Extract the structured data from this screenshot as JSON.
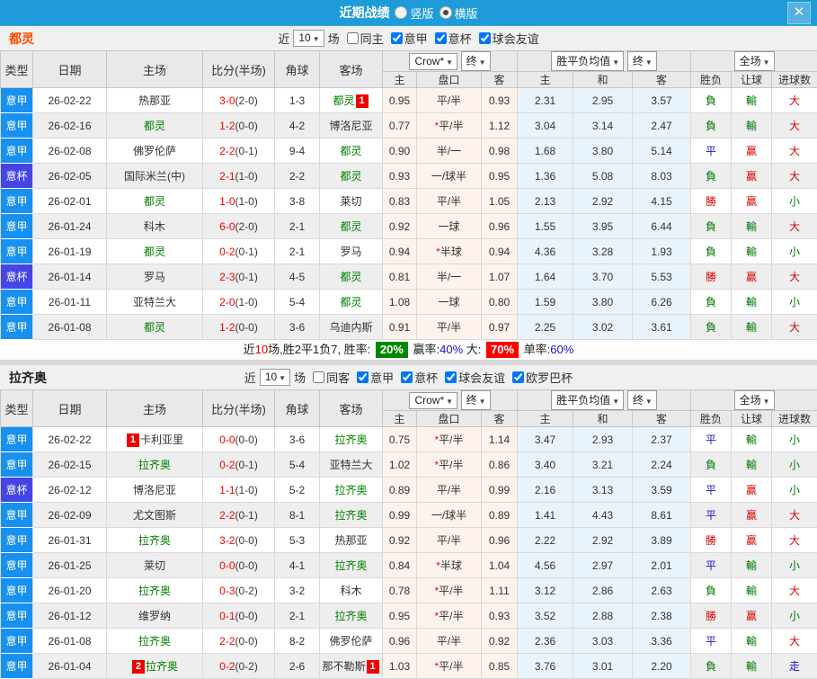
{
  "titlebar": {
    "title": "近期战绩",
    "radio_options": [
      {
        "label": "竖版",
        "selected": false
      },
      {
        "label": "横版",
        "selected": true
      }
    ],
    "close_label": "✕"
  },
  "table_header": {
    "type": "类型",
    "date": "日期",
    "home": "主场",
    "score": "比分(半场)",
    "corner": "角球",
    "away": "客场",
    "crow_dd": "Crow*",
    "final_dd": "终",
    "avg_dd": "胜平负均值",
    "final2_dd": "终",
    "full_dd": "全场",
    "sub": [
      "主",
      "盘口",
      "客",
      "主",
      "和",
      "客",
      "胜负",
      "让球",
      "进球数"
    ]
  },
  "colors": {
    "titlebar": "#1e9bd8",
    "serie_a": "#1890f0",
    "coppa": "#4545e6",
    "team_self": "#008000",
    "score_red": "#ff0000",
    "badge_red": "#ee0000",
    "crow_bg": "#fdf3ec",
    "avg_bg": "#e9f3fb",
    "win_red": "#dd0000",
    "lose_green": "#007700",
    "draw_blue": "#1414cc"
  },
  "sections": [
    {
      "team": "都灵",
      "team_color": "#ff4800",
      "filter": {
        "near": "近",
        "count": "10",
        "games": "场",
        "checkboxes": [
          {
            "label": "同主",
            "checked": false
          },
          {
            "label": "意甲",
            "checked": true
          },
          {
            "label": "意杯",
            "checked": true
          },
          {
            "label": "球会友谊",
            "checked": true
          }
        ]
      },
      "rows": [
        {
          "league": "意甲",
          "league_style": "jia",
          "date": "26-02-22",
          "home": {
            "name": "热那亚"
          },
          "score": "3-0",
          "half": "(2-0)",
          "corner": "1-3",
          "away": {
            "name": "都灵",
            "self": true,
            "badge_post": "1"
          },
          "crow_home": "0.95",
          "handicap": "平/半",
          "handicap_star": false,
          "crow_away": "0.93",
          "avg_home": "2.31",
          "avg_draw": "2.95",
          "avg_away": "3.57",
          "result": "負",
          "result_color": "green",
          "let": "輸",
          "let_color": "green",
          "goals": "大",
          "goals_color": "red"
        },
        {
          "league": "意甲",
          "league_style": "jia",
          "date": "26-02-16",
          "home": {
            "name": "都灵",
            "self": true
          },
          "score": "1-2",
          "half": "(0-0)",
          "corner": "4-2",
          "away": {
            "name": "博洛尼亚"
          },
          "crow_home": "0.77",
          "handicap": "平/半",
          "handicap_star": true,
          "crow_away": "1.12",
          "avg_home": "3.04",
          "avg_draw": "3.14",
          "avg_away": "2.47",
          "result": "負",
          "result_color": "green",
          "let": "輸",
          "let_color": "green",
          "goals": "大",
          "goals_color": "red"
        },
        {
          "league": "意甲",
          "league_style": "jia",
          "date": "26-02-08",
          "home": {
            "name": "佛罗伦萨"
          },
          "score": "2-2",
          "half": "(0-1)",
          "corner": "9-4",
          "away": {
            "name": "都灵",
            "self": true
          },
          "crow_home": "0.90",
          "handicap": "半/一",
          "handicap_star": false,
          "crow_away": "0.98",
          "avg_home": "1.68",
          "avg_draw": "3.80",
          "avg_away": "5.14",
          "result": "平",
          "result_color": "blue",
          "let": "赢",
          "let_color": "red",
          "goals": "大",
          "goals_color": "red"
        },
        {
          "league": "意杯",
          "league_style": "bei",
          "date": "26-02-05",
          "home": {
            "name": "国际米兰(中)"
          },
          "score": "2-1",
          "half": "(1-0)",
          "corner": "2-2",
          "away": {
            "name": "都灵",
            "self": true
          },
          "crow_home": "0.93",
          "handicap": "一/球半",
          "handicap_star": false,
          "crow_away": "0.95",
          "avg_home": "1.36",
          "avg_draw": "5.08",
          "avg_away": "8.03",
          "result": "負",
          "result_color": "green",
          "let": "赢",
          "let_color": "red",
          "goals": "大",
          "goals_color": "red"
        },
        {
          "league": "意甲",
          "league_style": "jia",
          "date": "26-02-01",
          "home": {
            "name": "都灵",
            "self": true
          },
          "score": "1-0",
          "half": "(1-0)",
          "corner": "3-8",
          "away": {
            "name": "莱切"
          },
          "crow_home": "0.83",
          "handicap": "平/半",
          "handicap_star": false,
          "crow_away": "1.05",
          "avg_home": "2.13",
          "avg_draw": "2.92",
          "avg_away": "4.15",
          "result": "勝",
          "result_color": "red",
          "let": "赢",
          "let_color": "red",
          "goals": "小",
          "goals_color": "green"
        },
        {
          "league": "意甲",
          "league_style": "jia",
          "date": "26-01-24",
          "home": {
            "name": "科木"
          },
          "score": "6-0",
          "half": "(2-0)",
          "corner": "2-1",
          "away": {
            "name": "都灵",
            "self": true
          },
          "crow_home": "0.92",
          "handicap": "一球",
          "handicap_star": false,
          "crow_away": "0.96",
          "avg_home": "1.55",
          "avg_draw": "3.95",
          "avg_away": "6.44",
          "result": "負",
          "result_color": "green",
          "let": "輸",
          "let_color": "green",
          "goals": "大",
          "goals_color": "red"
        },
        {
          "league": "意甲",
          "league_style": "jia",
          "date": "26-01-19",
          "home": {
            "name": "都灵",
            "self": true
          },
          "score": "0-2",
          "half": "(0-1)",
          "corner": "2-1",
          "away": {
            "name": "罗马"
          },
          "crow_home": "0.94",
          "handicap": "半球",
          "handicap_star": true,
          "crow_away": "0.94",
          "avg_home": "4.36",
          "avg_draw": "3.28",
          "avg_away": "1.93",
          "result": "負",
          "result_color": "green",
          "let": "輸",
          "let_color": "green",
          "goals": "小",
          "goals_color": "green"
        },
        {
          "league": "意杯",
          "league_style": "bei",
          "date": "26-01-14",
          "home": {
            "name": "罗马"
          },
          "score": "2-3",
          "half": "(0-1)",
          "corner": "4-5",
          "away": {
            "name": "都灵",
            "self": true
          },
          "crow_home": "0.81",
          "handicap": "半/一",
          "handicap_star": false,
          "crow_away": "1.07",
          "avg_home": "1.64",
          "avg_draw": "3.70",
          "avg_away": "5.53",
          "result": "勝",
          "result_color": "red",
          "let": "赢",
          "let_color": "red",
          "goals": "大",
          "goals_color": "red"
        },
        {
          "league": "意甲",
          "league_style": "jia",
          "date": "26-01-11",
          "home": {
            "name": "亚特兰大"
          },
          "score": "2-0",
          "half": "(1-0)",
          "corner": "5-4",
          "away": {
            "name": "都灵",
            "self": true
          },
          "crow_home": "1.08",
          "handicap": "一球",
          "handicap_star": false,
          "crow_away": "0.80",
          "avg_home": "1.59",
          "avg_draw": "3.80",
          "avg_away": "6.26",
          "result": "負",
          "result_color": "green",
          "let": "輸",
          "let_color": "green",
          "goals": "小",
          "goals_color": "green"
        },
        {
          "league": "意甲",
          "league_style": "jia",
          "date": "26-01-08",
          "home": {
            "name": "都灵",
            "self": true
          },
          "score": "1-2",
          "half": "(0-0)",
          "corner": "3-6",
          "away": {
            "name": "乌迪内斯"
          },
          "crow_home": "0.91",
          "handicap": "平/半",
          "handicap_star": false,
          "crow_away": "0.97",
          "avg_home": "2.25",
          "avg_draw": "3.02",
          "avg_away": "3.61",
          "result": "負",
          "result_color": "green",
          "let": "輸",
          "let_color": "green",
          "goals": "大",
          "goals_color": "red"
        }
      ],
      "summary": {
        "near": "近",
        "count": "10",
        "text1": "场,胜2平1负7, 胜率:",
        "win_rate": "20%",
        "text2": "赢率:",
        "handicap_rate": "40%",
        "text3": "大:",
        "big_rate": "70%",
        "text4": "单率:",
        "single_rate": "60%"
      }
    },
    {
      "team": "拉齐奥",
      "team_color": "#222222",
      "filter": {
        "near": "近",
        "count": "10",
        "games": "场",
        "checkboxes": [
          {
            "label": "同客",
            "checked": false
          },
          {
            "label": "意甲",
            "checked": true
          },
          {
            "label": "意杯",
            "checked": true
          },
          {
            "label": "球会友谊",
            "checked": true
          },
          {
            "label": "欧罗巴杯",
            "checked": true
          }
        ]
      },
      "rows": [
        {
          "league": "意甲",
          "league_style": "jia",
          "date": "26-02-22",
          "home": {
            "name": "卡利亚里",
            "badge_pre": "1"
          },
          "score": "0-0",
          "half": "(0-0)",
          "corner": "3-6",
          "away": {
            "name": "拉齐奥",
            "self": true
          },
          "crow_home": "0.75",
          "handicap": "平/半",
          "handicap_star": true,
          "crow_away": "1.14",
          "avg_home": "3.47",
          "avg_draw": "2.93",
          "avg_away": "2.37",
          "result": "平",
          "result_color": "blue",
          "let": "輸",
          "let_color": "green",
          "goals": "小",
          "goals_color": "green"
        },
        {
          "league": "意甲",
          "league_style": "jia",
          "date": "26-02-15",
          "home": {
            "name": "拉齐奥",
            "self": true
          },
          "score": "0-2",
          "half": "(0-1)",
          "corner": "5-4",
          "away": {
            "name": "亚特兰大"
          },
          "crow_home": "1.02",
          "handicap": "平/半",
          "handicap_star": true,
          "crow_away": "0.86",
          "avg_home": "3.40",
          "avg_draw": "3.21",
          "avg_away": "2.24",
          "result": "負",
          "result_color": "green",
          "let": "輸",
          "let_color": "green",
          "goals": "小",
          "goals_color": "green"
        },
        {
          "league": "意杯",
          "league_style": "bei",
          "date": "26-02-12",
          "home": {
            "name": "博洛尼亚"
          },
          "score": "1-1",
          "half": "(1-0)",
          "corner": "5-2",
          "away": {
            "name": "拉齐奥",
            "self": true
          },
          "crow_home": "0.89",
          "handicap": "平/半",
          "handicap_star": false,
          "crow_away": "0.99",
          "avg_home": "2.16",
          "avg_draw": "3.13",
          "avg_away": "3.59",
          "result": "平",
          "result_color": "blue",
          "let": "赢",
          "let_color": "red",
          "goals": "小",
          "goals_color": "green"
        },
        {
          "league": "意甲",
          "league_style": "jia",
          "date": "26-02-09",
          "home": {
            "name": "尤文图斯"
          },
          "score": "2-2",
          "half": "(0-1)",
          "corner": "8-1",
          "away": {
            "name": "拉齐奥",
            "self": true
          },
          "crow_home": "0.99",
          "handicap": "一/球半",
          "handicap_star": false,
          "crow_away": "0.89",
          "avg_home": "1.41",
          "avg_draw": "4.43",
          "avg_away": "8.61",
          "result": "平",
          "result_color": "blue",
          "let": "赢",
          "let_color": "red",
          "goals": "大",
          "goals_color": "red"
        },
        {
          "league": "意甲",
          "league_style": "jia",
          "date": "26-01-31",
          "home": {
            "name": "拉齐奥",
            "self": true
          },
          "score": "3-2",
          "half": "(0-0)",
          "corner": "5-3",
          "away": {
            "name": "热那亚"
          },
          "crow_home": "0.92",
          "handicap": "平/半",
          "handicap_star": false,
          "crow_away": "0.96",
          "avg_home": "2.22",
          "avg_draw": "2.92",
          "avg_away": "3.89",
          "result": "勝",
          "result_color": "red",
          "let": "赢",
          "let_color": "red",
          "goals": "大",
          "goals_color": "red"
        },
        {
          "league": "意甲",
          "league_style": "jia",
          "date": "26-01-25",
          "home": {
            "name": "莱切"
          },
          "score": "0-0",
          "half": "(0-0)",
          "corner": "4-1",
          "away": {
            "name": "拉齐奥",
            "self": true
          },
          "crow_home": "0.84",
          "handicap": "半球",
          "handicap_star": true,
          "crow_away": "1.04",
          "avg_home": "4.56",
          "avg_draw": "2.97",
          "avg_away": "2.01",
          "result": "平",
          "result_color": "blue",
          "let": "輸",
          "let_color": "green",
          "goals": "小",
          "goals_color": "green"
        },
        {
          "league": "意甲",
          "league_style": "jia",
          "date": "26-01-20",
          "home": {
            "name": "拉齐奥",
            "self": true
          },
          "score": "0-3",
          "half": "(0-2)",
          "corner": "3-2",
          "away": {
            "name": "科木"
          },
          "crow_home": "0.78",
          "handicap": "平/半",
          "handicap_star": true,
          "crow_away": "1.11",
          "avg_home": "3.12",
          "avg_draw": "2.86",
          "avg_away": "2.63",
          "result": "負",
          "result_color": "green",
          "let": "輸",
          "let_color": "green",
          "goals": "大",
          "goals_color": "red"
        },
        {
          "league": "意甲",
          "league_style": "jia",
          "date": "26-01-12",
          "home": {
            "name": "维罗纳"
          },
          "score": "0-1",
          "half": "(0-0)",
          "corner": "2-1",
          "away": {
            "name": "拉齐奥",
            "self": true
          },
          "crow_home": "0.95",
          "handicap": "平/半",
          "handicap_star": true,
          "crow_away": "0.93",
          "avg_home": "3.52",
          "avg_draw": "2.88",
          "avg_away": "2.38",
          "result": "勝",
          "result_color": "red",
          "let": "赢",
          "let_color": "red",
          "goals": "小",
          "goals_color": "green"
        },
        {
          "league": "意甲",
          "league_style": "jia",
          "date": "26-01-08",
          "home": {
            "name": "拉齐奥",
            "self": true
          },
          "score": "2-2",
          "half": "(0-0)",
          "corner": "8-2",
          "away": {
            "name": "佛罗伦萨"
          },
          "crow_home": "0.96",
          "handicap": "平/半",
          "handicap_star": false,
          "crow_away": "0.92",
          "avg_home": "2.36",
          "avg_draw": "3.03",
          "avg_away": "3.36",
          "result": "平",
          "result_color": "blue",
          "let": "輸",
          "let_color": "green",
          "goals": "大",
          "goals_color": "red"
        },
        {
          "league": "意甲",
          "league_style": "jia",
          "date": "26-01-04",
          "home": {
            "name": "拉齐奥",
            "self": true,
            "badge_pre": "2"
          },
          "score": "0-2",
          "half": "(0-2)",
          "corner": "2-6",
          "away": {
            "name": "那不勒斯",
            "badge_post": "1"
          },
          "crow_home": "1.03",
          "handicap": "平/半",
          "handicap_star": true,
          "crow_away": "0.85",
          "avg_home": "3.76",
          "avg_draw": "3.01",
          "avg_away": "2.20",
          "result": "負",
          "result_color": "green",
          "let": "輸",
          "let_color": "green",
          "goals": "走",
          "goals_color": "blue"
        }
      ],
      "summary": null
    }
  ]
}
